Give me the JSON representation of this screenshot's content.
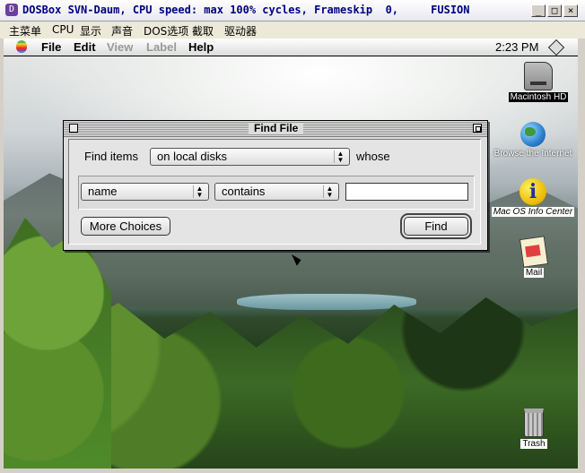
{
  "host_window": {
    "title": "DOSBox SVN-Daum, CPU speed: max 100% cycles, Frameskip  0,     FUSION",
    "menu": [
      "主菜单",
      "CPU",
      "显示",
      "声音",
      "DOS选项",
      "截取",
      "驱动器"
    ],
    "controls": {
      "minimize": "_",
      "maximize": "□",
      "close": "×"
    }
  },
  "mac_menubar": {
    "items": [
      {
        "label": "File",
        "enabled": true
      },
      {
        "label": "Edit",
        "enabled": true
      },
      {
        "label": "View",
        "enabled": false
      },
      {
        "label": "Label",
        "enabled": false
      },
      {
        "label": "Help",
        "enabled": true
      }
    ],
    "clock": "2:23 PM"
  },
  "desktop_icons": [
    {
      "label": "Macintosh HD",
      "icon": "hard-disk-icon"
    },
    {
      "label": "Browse the Internet",
      "icon": "globe-icon"
    },
    {
      "label": "Mac OS Info Center",
      "icon": "info-icon"
    },
    {
      "label": "Mail",
      "icon": "mail-icon"
    },
    {
      "label": "Trash",
      "icon": "trash-icon"
    }
  ],
  "find_file": {
    "title": "Find File",
    "find_items_label": "Find items",
    "scope_value": "on local disks",
    "whose_label": "whose",
    "criteria": {
      "attribute": "name",
      "operator": "contains",
      "value": ""
    },
    "more_choices_label": "More Choices",
    "find_label": "Find"
  }
}
